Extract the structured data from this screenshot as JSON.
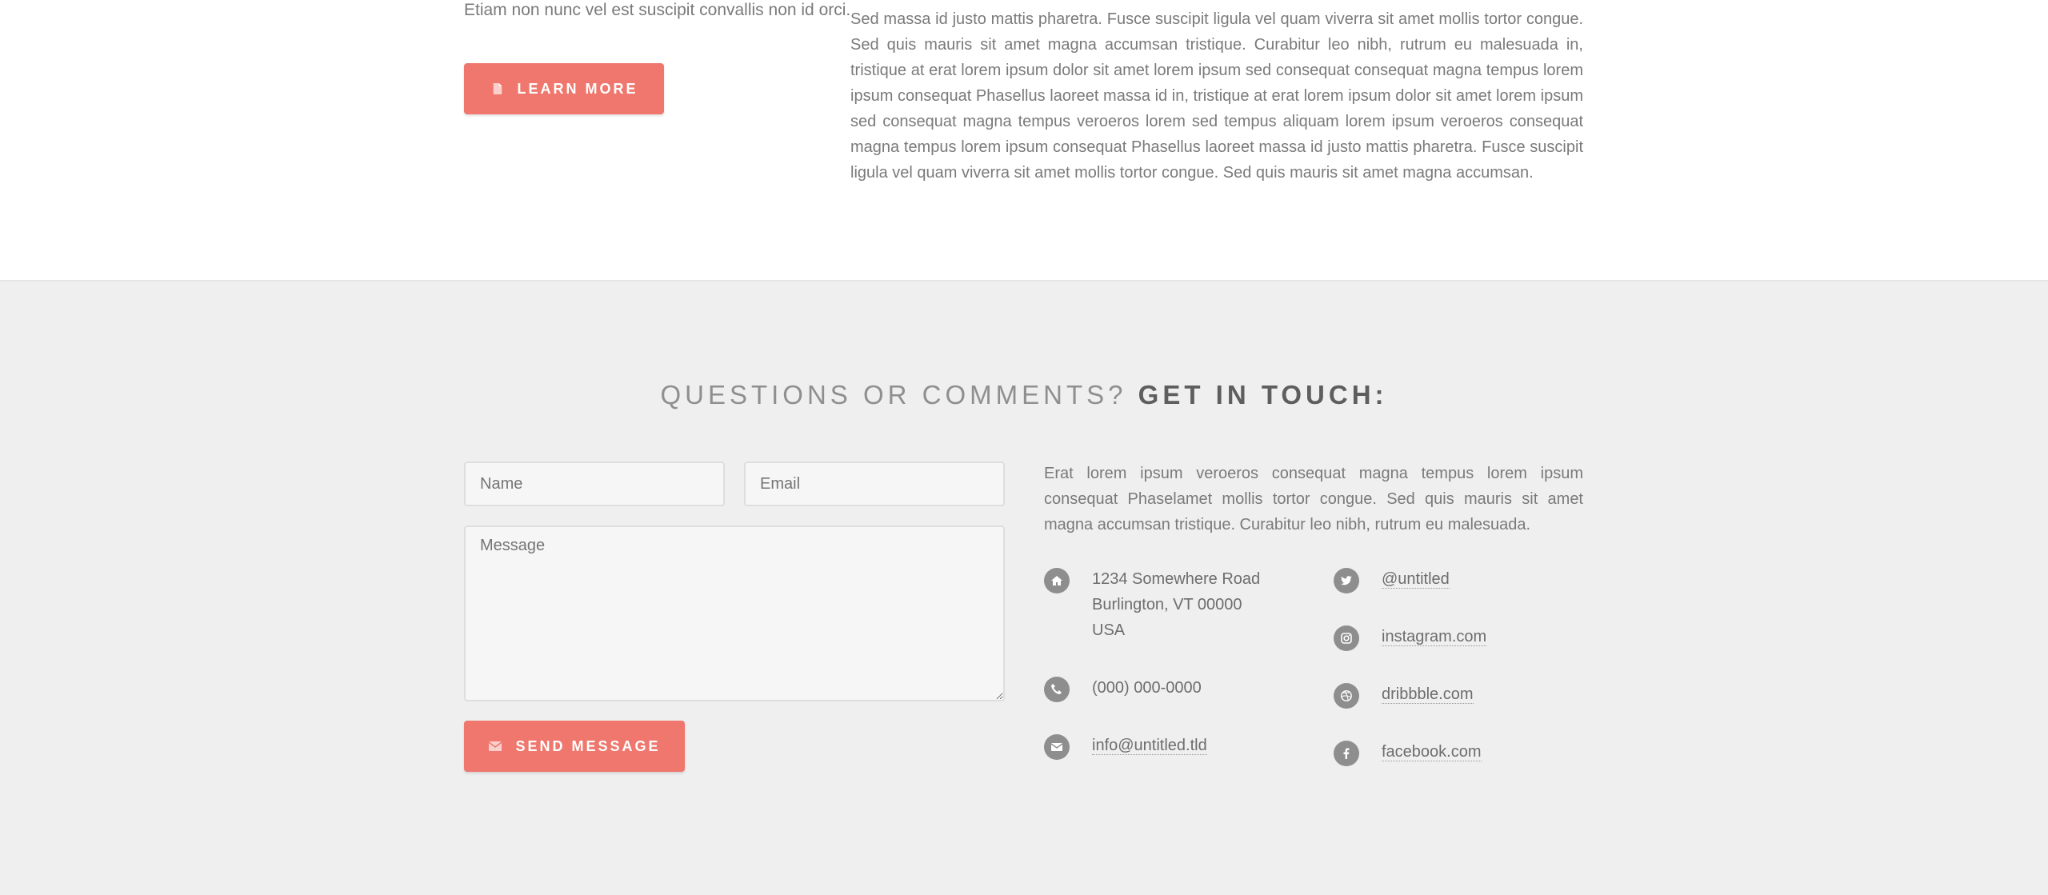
{
  "top": {
    "left_text": "Etiam non nunc vel est suscipit convallis non id orci.",
    "learn_more_label": "LEARN MORE",
    "right_paragraph": "Sed massa id justo mattis pharetra. Fusce suscipit ligula vel quam viverra sit amet mollis tortor congue. Sed quis mauris sit amet magna accumsan tristique. Curabitur leo nibh, rutrum eu malesuada in, tristique at erat lorem ipsum dolor sit amet lorem ipsum sed consequat consequat magna tempus lorem ipsum consequat Phasellus laoreet massa id in, tristique at erat lorem ipsum dolor sit amet lorem ipsum sed consequat magna tempus veroeros lorem sed tempus aliquam lorem ipsum veroeros consequat magna tempus lorem ipsum consequat Phasellus laoreet massa id justo mattis pharetra. Fusce suscipit ligula vel quam viverra sit amet mollis tortor congue. Sed quis mauris sit amet magna accumsan."
  },
  "contact": {
    "heading_light": "QUESTIONS OR COMMENTS?",
    "heading_bold": "GET IN TOUCH:",
    "form": {
      "name_placeholder": "Name",
      "email_placeholder": "Email",
      "message_placeholder": "Message",
      "send_label": "SEND MESSAGE"
    },
    "paragraph": "Erat lorem ipsum veroeros consequat magna tempus lorem ipsum consequat Phaselamet mollis tortor congue. Sed quis mauris sit amet magna accumsan tristique. Curabitur leo nibh, rutrum eu malesuada.",
    "address": [
      "1234 Somewhere Road",
      "Burlington, VT 00000",
      "USA"
    ],
    "phone": "(000) 000-0000",
    "email": "info@untitled.tld",
    "twitter": "@untitled",
    "instagram": "instagram.com",
    "dribbble": "dribbble.com",
    "facebook": "facebook.com"
  },
  "colors": {
    "accent": "#ef776d",
    "section_bg": "#efefef",
    "icon_circle": "#8e8e8e"
  },
  "icons": {
    "learn_more": "document-icon",
    "send": "envelope-icon",
    "address": "home-icon",
    "phone": "phone-icon",
    "email": "envelope-icon",
    "twitter": "twitter-icon",
    "instagram": "instagram-icon",
    "dribbble": "dribbble-icon",
    "facebook": "facebook-icon"
  }
}
